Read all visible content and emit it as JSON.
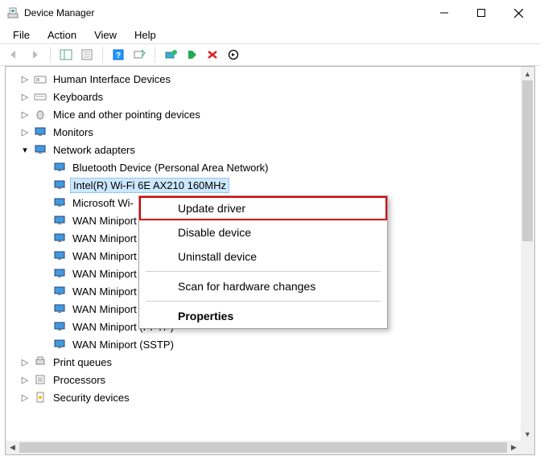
{
  "window": {
    "title": "Device Manager"
  },
  "menu": {
    "file": "File",
    "action": "Action",
    "view": "View",
    "help": "Help"
  },
  "tree": {
    "hid": "Human Interface Devices",
    "keyboards": "Keyboards",
    "mice": "Mice and other pointing devices",
    "monitors": "Monitors",
    "network": "Network adapters",
    "bt": "Bluetooth Device (Personal Area Network)",
    "wifi": "Intel(R) Wi-Fi 6E AX210 160MHz",
    "ms": "Microsoft Wi-",
    "wan1": "WAN Miniport",
    "wan2": "WAN Miniport",
    "wan3": "WAN Miniport",
    "wan4": "WAN Miniport",
    "wan5": "WAN Miniport",
    "wan6": "WAN Miniport",
    "wan7": "WAN Miniport (PPTP)",
    "wan8": "WAN Miniport (SSTP)",
    "print": "Print queues",
    "proc": "Processors",
    "sec": "Security devices"
  },
  "context_menu": {
    "update": "Update driver",
    "disable": "Disable device",
    "uninstall": "Uninstall device",
    "scan": "Scan for hardware changes",
    "properties": "Properties"
  }
}
